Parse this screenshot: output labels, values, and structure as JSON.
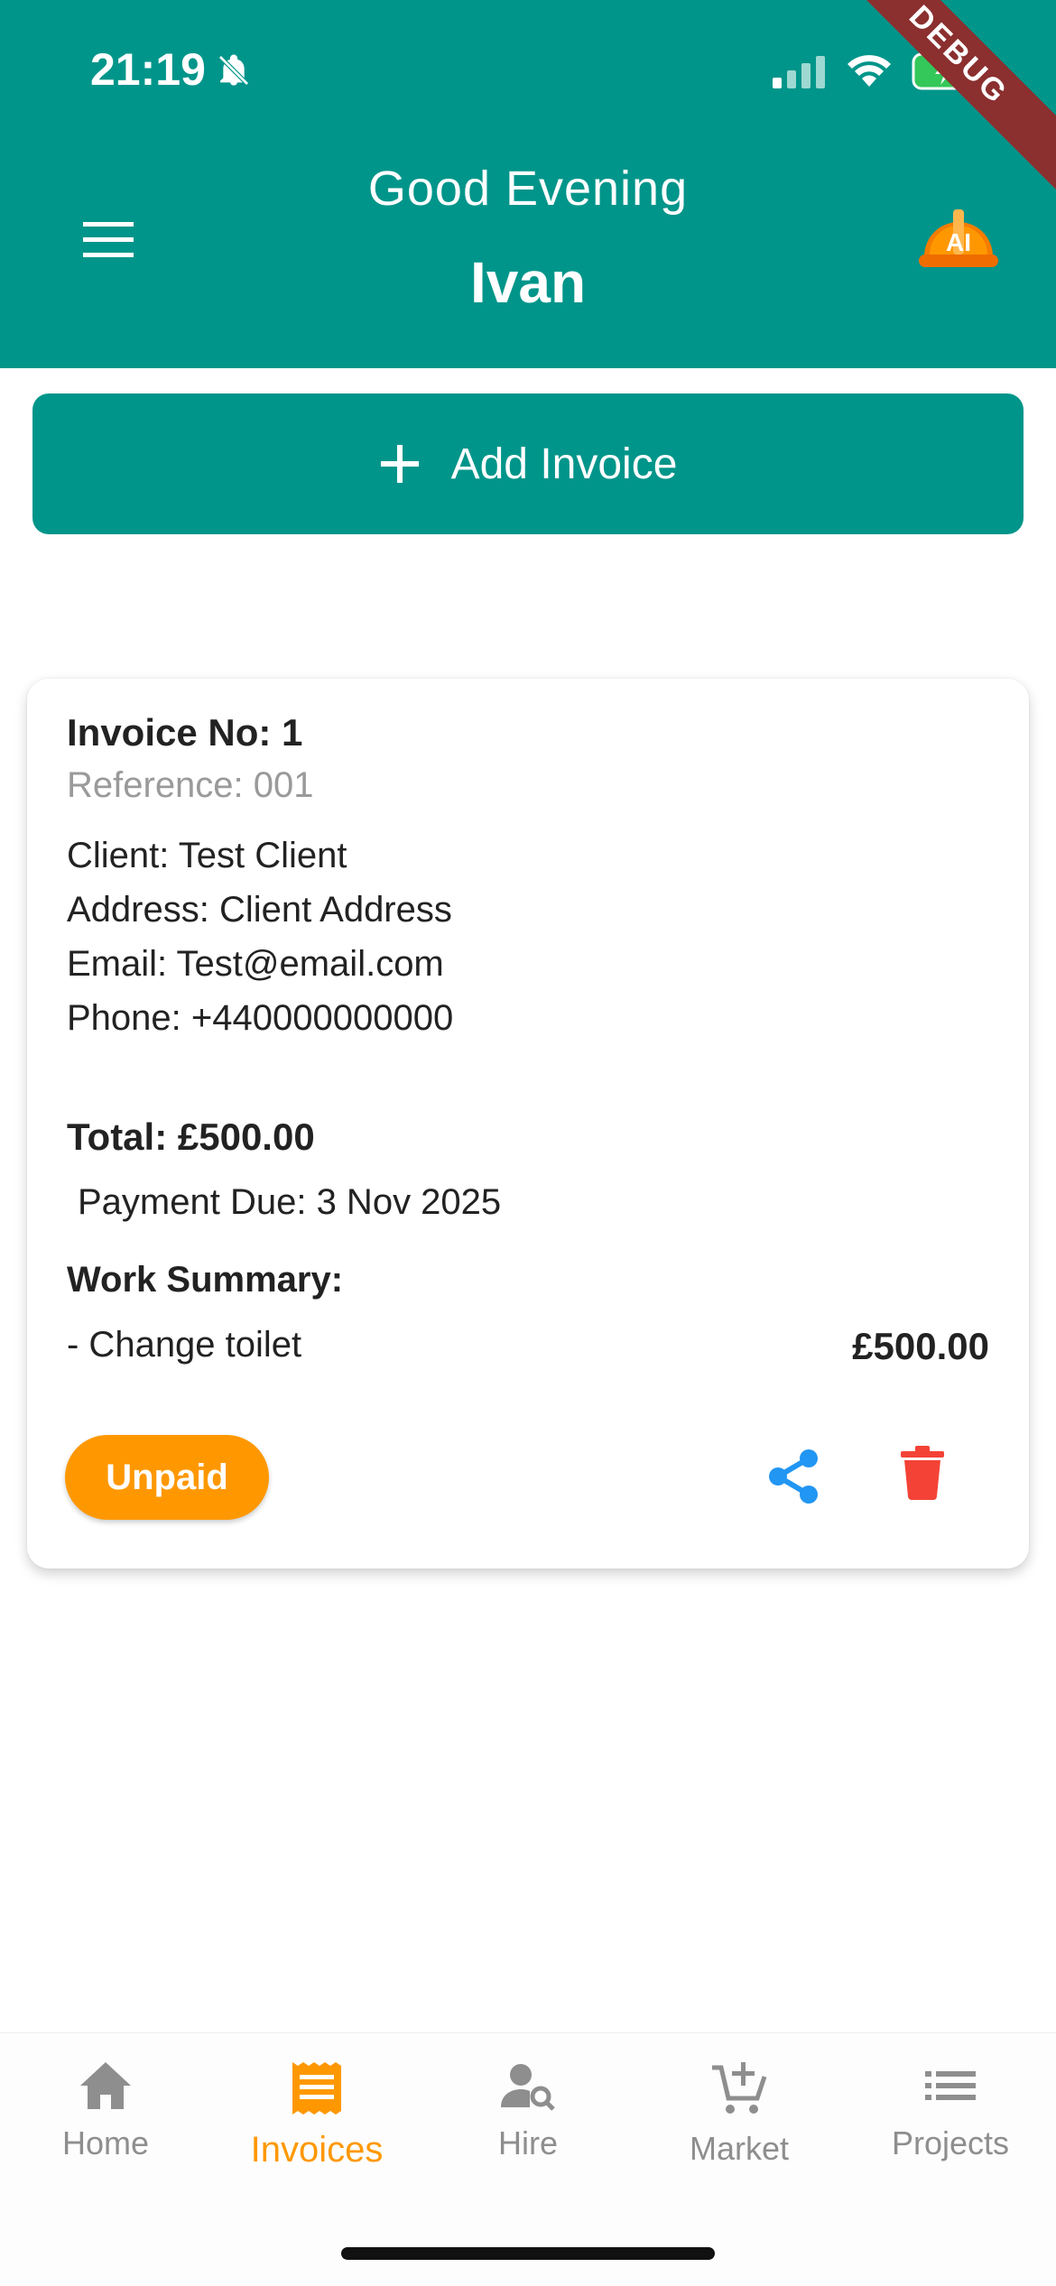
{
  "status_bar": {
    "time": "21:19",
    "debug_label": "DEBUG"
  },
  "header": {
    "greeting": "Good Evening",
    "user_name": "Ivan",
    "ai_badge_text": "AI"
  },
  "add_invoice": {
    "label": "Add Invoice"
  },
  "invoice": {
    "number": "Invoice No: 1",
    "reference": "Reference: 001",
    "client": "Client: Test Client",
    "address": "Address: Client Address",
    "email": "Email: Test@email.com",
    "phone": "Phone: +440000000000",
    "total": "Total: £500.00",
    "payment_due": "Payment Due: 3 Nov 2025",
    "work_summary_title": "Work Summary:",
    "items": [
      {
        "description": "- Change toilet",
        "amount": "£500.00"
      }
    ],
    "status": "Unpaid"
  },
  "colors": {
    "primary": "#00958A",
    "accent": "#FF9800",
    "share": "#2196F3",
    "delete": "#F44336"
  },
  "bottom_nav": {
    "active": "Invoices",
    "items": [
      {
        "label": "Home",
        "icon": "home-icon"
      },
      {
        "label": "Invoices",
        "icon": "receipt-icon"
      },
      {
        "label": "Hire",
        "icon": "person-search-icon"
      },
      {
        "label": "Market",
        "icon": "cart-add-icon"
      },
      {
        "label": "Projects",
        "icon": "list-icon"
      }
    ]
  }
}
